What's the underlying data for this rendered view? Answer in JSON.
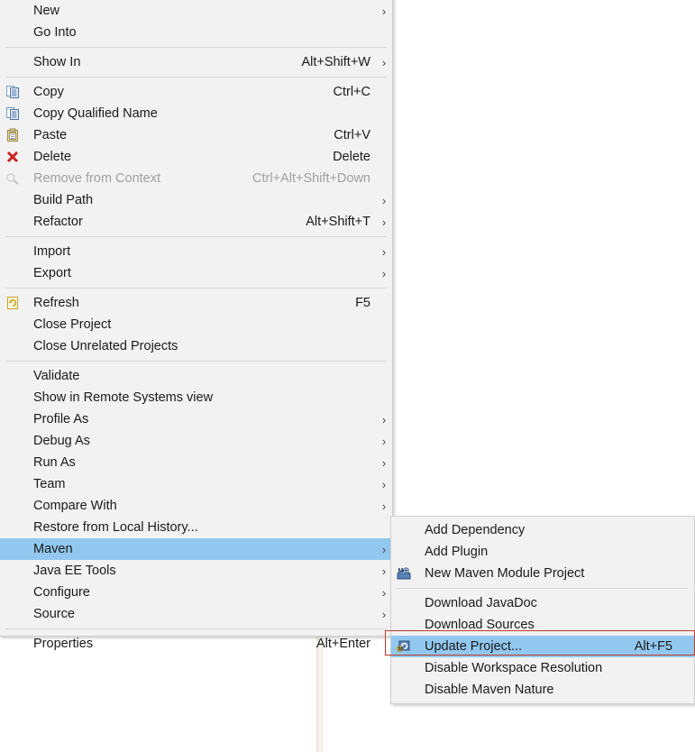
{
  "app": {
    "kind": "eclipse-project-context-menu",
    "colors": {
      "menu_background": "#f2f2f2",
      "menu_border": "#cfcfcf",
      "selection": "#92c8ef",
      "separator": "#dadada",
      "text": "#1a1a1a",
      "text_disabled": "#a0a0a0",
      "highlight_box": "#c0392b"
    }
  },
  "context_menu": {
    "name": "project-context-menu",
    "groups": [
      {
        "items": [
          {
            "label": "New",
            "accel": "",
            "submenu": true,
            "icon": "",
            "state": "normal"
          },
          {
            "label": "Go Into",
            "accel": "",
            "submenu": false,
            "icon": "",
            "state": "normal"
          }
        ]
      },
      {
        "items": [
          {
            "label": "Show In",
            "accel": "Alt+Shift+W",
            "submenu": true,
            "icon": "",
            "state": "normal"
          }
        ]
      },
      {
        "items": [
          {
            "label": "Copy",
            "accel": "Ctrl+C",
            "submenu": false,
            "icon": "copy-icon",
            "state": "normal"
          },
          {
            "label": "Copy Qualified Name",
            "accel": "",
            "submenu": false,
            "icon": "copy-qualified-name-icon",
            "state": "normal"
          },
          {
            "label": "Paste",
            "accel": "Ctrl+V",
            "submenu": false,
            "icon": "paste-icon",
            "state": "normal"
          },
          {
            "label": "Delete",
            "accel": "Delete",
            "submenu": false,
            "icon": "delete-icon",
            "state": "normal"
          },
          {
            "label": "Remove from Context",
            "accel": "Ctrl+Alt+Shift+Down",
            "submenu": false,
            "icon": "remove-from-context-icon",
            "state": "disabled"
          },
          {
            "label": "Build Path",
            "accel": "",
            "submenu": true,
            "icon": "",
            "state": "normal"
          },
          {
            "label": "Refactor",
            "accel": "Alt+Shift+T",
            "submenu": true,
            "icon": "",
            "state": "normal"
          }
        ]
      },
      {
        "items": [
          {
            "label": "Import",
            "accel": "",
            "submenu": true,
            "icon": "",
            "state": "normal"
          },
          {
            "label": "Export",
            "accel": "",
            "submenu": true,
            "icon": "",
            "state": "normal"
          }
        ]
      },
      {
        "items": [
          {
            "label": "Refresh",
            "accel": "F5",
            "submenu": false,
            "icon": "refresh-icon",
            "state": "normal"
          },
          {
            "label": "Close Project",
            "accel": "",
            "submenu": false,
            "icon": "",
            "state": "normal"
          },
          {
            "label": "Close Unrelated Projects",
            "accel": "",
            "submenu": false,
            "icon": "",
            "state": "normal"
          }
        ]
      },
      {
        "items": [
          {
            "label": "Validate",
            "accel": "",
            "submenu": false,
            "icon": "",
            "state": "normal"
          },
          {
            "label": "Show in Remote Systems view",
            "accel": "",
            "submenu": false,
            "icon": "",
            "state": "normal"
          },
          {
            "label": "Profile As",
            "accel": "",
            "submenu": true,
            "icon": "",
            "state": "normal"
          },
          {
            "label": "Debug As",
            "accel": "",
            "submenu": true,
            "icon": "",
            "state": "normal"
          },
          {
            "label": "Run As",
            "accel": "",
            "submenu": true,
            "icon": "",
            "state": "normal"
          },
          {
            "label": "Team",
            "accel": "",
            "submenu": true,
            "icon": "",
            "state": "normal"
          },
          {
            "label": "Compare With",
            "accel": "",
            "submenu": true,
            "icon": "",
            "state": "normal"
          },
          {
            "label": "Restore from Local History...",
            "accel": "",
            "submenu": false,
            "icon": "",
            "state": "normal"
          },
          {
            "label": "Maven",
            "accel": "",
            "submenu": true,
            "icon": "",
            "state": "selected"
          },
          {
            "label": "Java EE Tools",
            "accel": "",
            "submenu": true,
            "icon": "",
            "state": "normal"
          },
          {
            "label": "Configure",
            "accel": "",
            "submenu": true,
            "icon": "",
            "state": "normal"
          },
          {
            "label": "Source",
            "accel": "",
            "submenu": true,
            "icon": "",
            "state": "normal"
          }
        ]
      },
      {
        "items": [
          {
            "label": "Properties",
            "accel": "Alt+Enter",
            "submenu": false,
            "icon": "",
            "state": "normal"
          }
        ]
      }
    ]
  },
  "maven_submenu": {
    "name": "maven-submenu",
    "groups": [
      {
        "items": [
          {
            "label": "Add Dependency",
            "accel": "",
            "submenu": false,
            "icon": "",
            "state": "normal"
          },
          {
            "label": "Add Plugin",
            "accel": "",
            "submenu": false,
            "icon": "",
            "state": "normal"
          },
          {
            "label": "New Maven Module Project",
            "accel": "",
            "submenu": false,
            "icon": "maven-module-project-icon",
            "state": "normal"
          }
        ]
      },
      {
        "items": [
          {
            "label": "Download JavaDoc",
            "accel": "",
            "submenu": false,
            "icon": "",
            "state": "normal"
          },
          {
            "label": "Download Sources",
            "accel": "",
            "submenu": false,
            "icon": "",
            "state": "normal"
          },
          {
            "label": "Update Project...",
            "accel": "Alt+F5",
            "submenu": false,
            "icon": "maven-update-project-icon",
            "state": "selected"
          },
          {
            "label": "Disable Workspace Resolution",
            "accel": "",
            "submenu": false,
            "icon": "",
            "state": "normal"
          },
          {
            "label": "Disable Maven Nature",
            "accel": "",
            "submenu": false,
            "icon": "",
            "state": "normal"
          }
        ]
      }
    ]
  },
  "annotation": {
    "highlight_target": "Update Project...",
    "highlight_color": "#c0392b"
  }
}
